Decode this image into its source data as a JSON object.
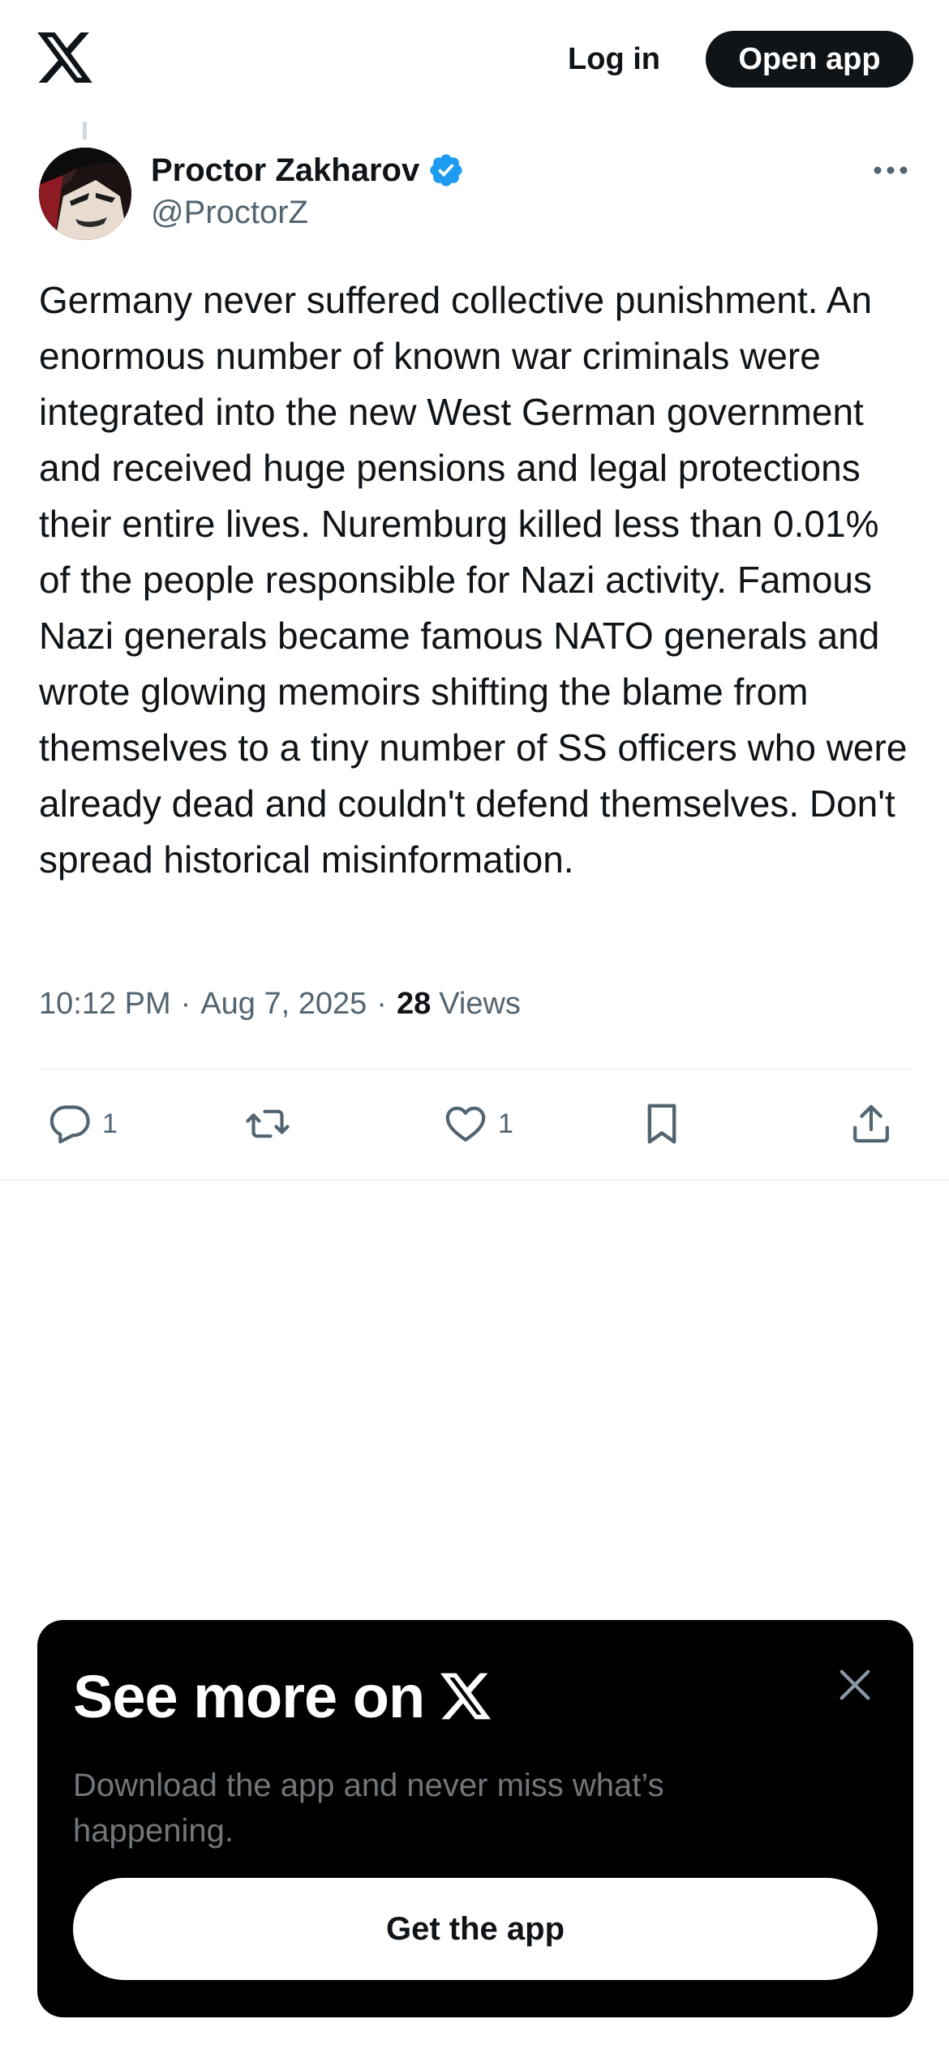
{
  "header": {
    "logo_icon": "x-logo-icon",
    "login_label": "Log in",
    "open_app_label": "Open app"
  },
  "post": {
    "author_name": "Proctor Zakharov",
    "handle": "@ProctorZ",
    "verified": true,
    "text": "Germany never suffered collective punishment. An enormous number of known war criminals were integrated into the new West German government and received huge pensions and legal protections their entire lives. Nuremburg killed less than 0.01% of the people responsible for Nazi activity. Famous Nazi generals became famous NATO generals and wrote glowing memoirs shifting the blame from themselves to a tiny number of SS officers who were already dead and couldn't defend themselves. Don't spread historical misinformation.",
    "time": "10:12 PM",
    "date": "Aug 7, 2025",
    "views_count": "28",
    "views_label": "Views",
    "separator": "·"
  },
  "actions": {
    "reply_count": "1",
    "like_count": "1",
    "icons": [
      "reply-icon",
      "retweet-icon",
      "like-icon",
      "bookmark-icon",
      "share-icon"
    ]
  },
  "promo": {
    "title": "See more on",
    "subtitle": "Download the app and never miss what’s happening.",
    "button_label": "Get the app"
  },
  "colors": {
    "text_primary": "#0f1419",
    "text_secondary": "#536471",
    "verified_blue": "#1d9bf0",
    "promo_background": "#000000",
    "promo_subtitle": "#71767b"
  }
}
